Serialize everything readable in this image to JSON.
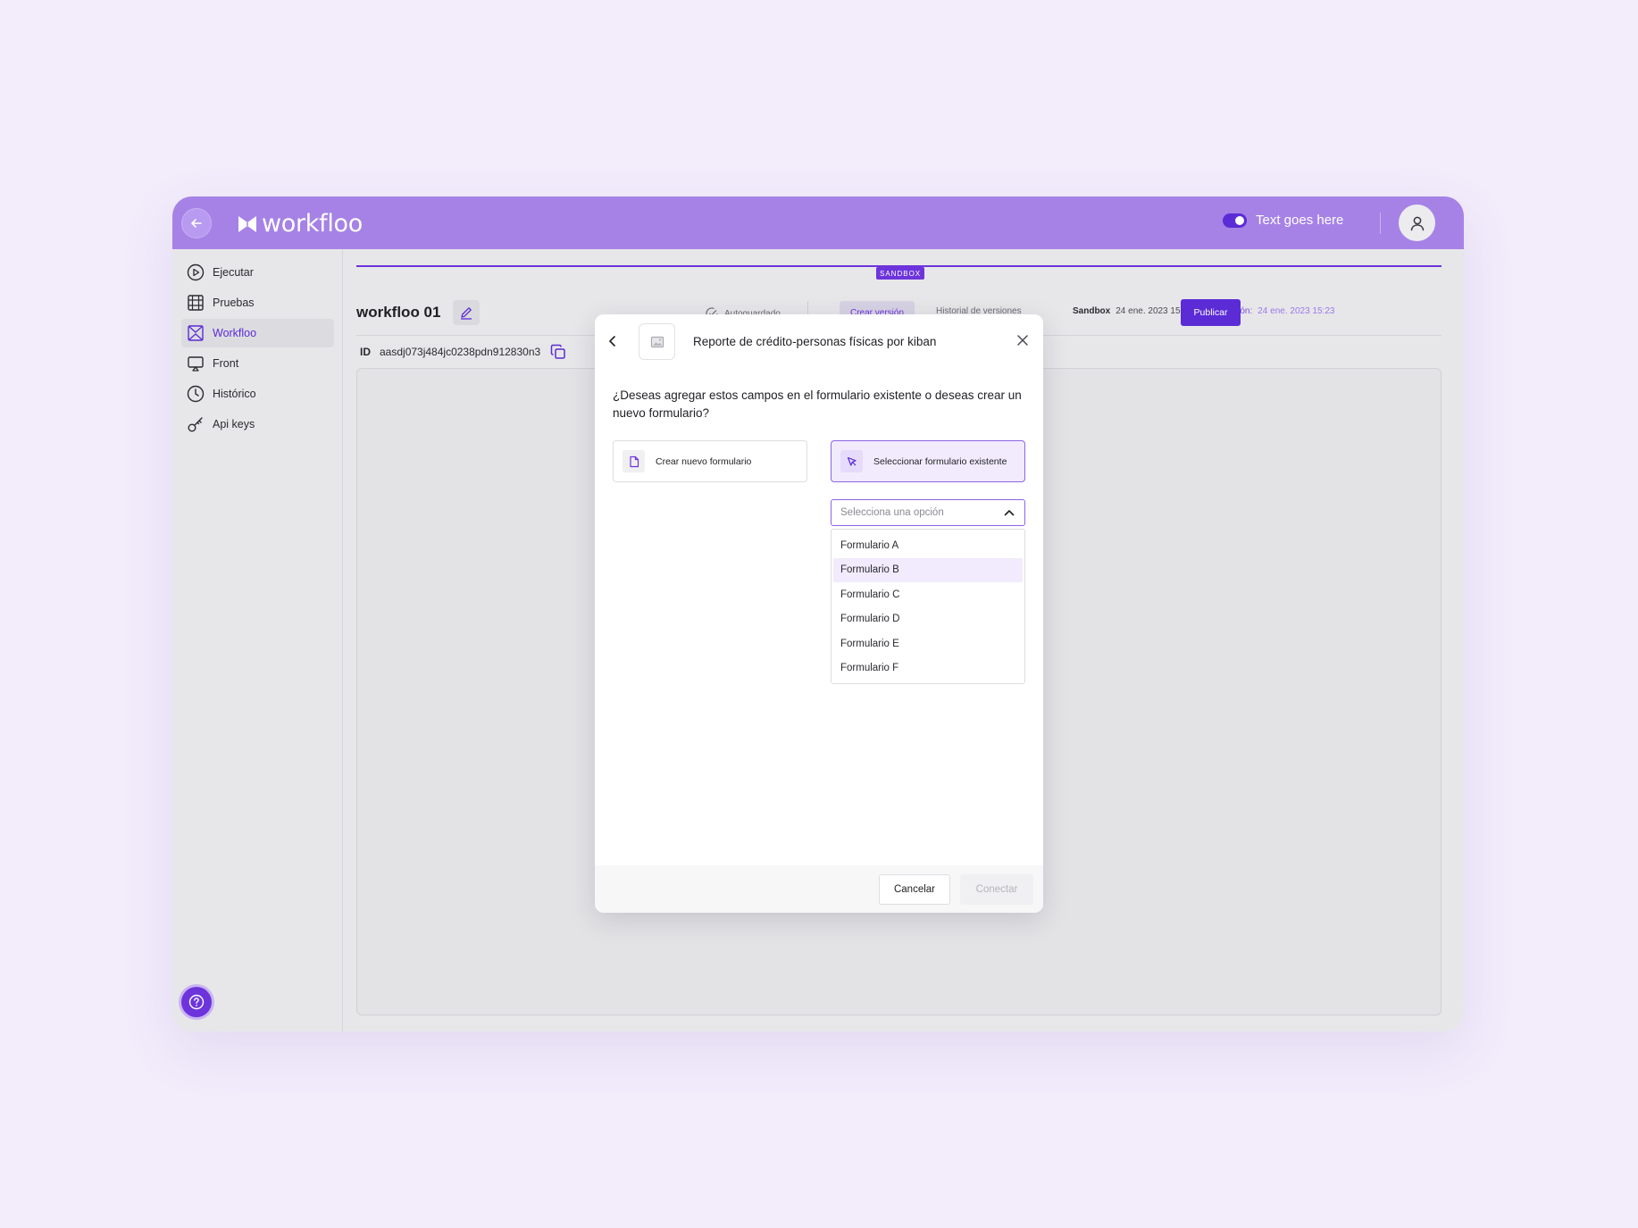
{
  "brand": {
    "name": "workfloo"
  },
  "topbar": {
    "toggle_label": "Text goes here"
  },
  "sidebar": {
    "items": [
      {
        "label": "Ejecutar",
        "icon": "play-circle-icon"
      },
      {
        "label": "Pruebas",
        "icon": "film-grid-icon"
      },
      {
        "label": "Workfloo",
        "icon": "workflow-icon",
        "active": true
      },
      {
        "label": "Front",
        "icon": "monitor-icon"
      },
      {
        "label": "Histórico",
        "icon": "clock-icon"
      },
      {
        "label": "Api keys",
        "icon": "key-icon"
      }
    ]
  },
  "header": {
    "sandbox_badge": "SANDBOX",
    "workflow_title": "workfloo 01",
    "id_label": "ID",
    "id_value": "aasdj073j484jc0238pdn912830n3",
    "autosave": "Autoguardado",
    "tab_create": "Crear versión",
    "tab_history": "Historial de versiones",
    "sandbox_label": "Sandbox",
    "sandbox_date": "24 ene. 2023 15:23",
    "production_label": "Producción:",
    "production_date": "24 ene. 2023 15:23",
    "publish_button": "Publicar"
  },
  "modal": {
    "title": "Reporte de crédito-personas físicas por kiban",
    "question": "¿Deseas agregar estos campos en el formulario existente o deseas crear un nuevo formulario?",
    "option_new": "Crear nuevo formulario",
    "option_existing": "Seleccionar formulario existente",
    "select_placeholder": "Selecciona una opción",
    "dropdown_options": [
      "Formulario A",
      "Formulario B",
      "Formulario C",
      "Formulario D",
      "Formulario E",
      "Formulario F"
    ],
    "cancel_button": "Cancelar",
    "connect_button": "Conectar"
  },
  "colors": {
    "topbar": "#a682e6",
    "accent": "#5b2bd6",
    "background": "#f2ecfb"
  }
}
